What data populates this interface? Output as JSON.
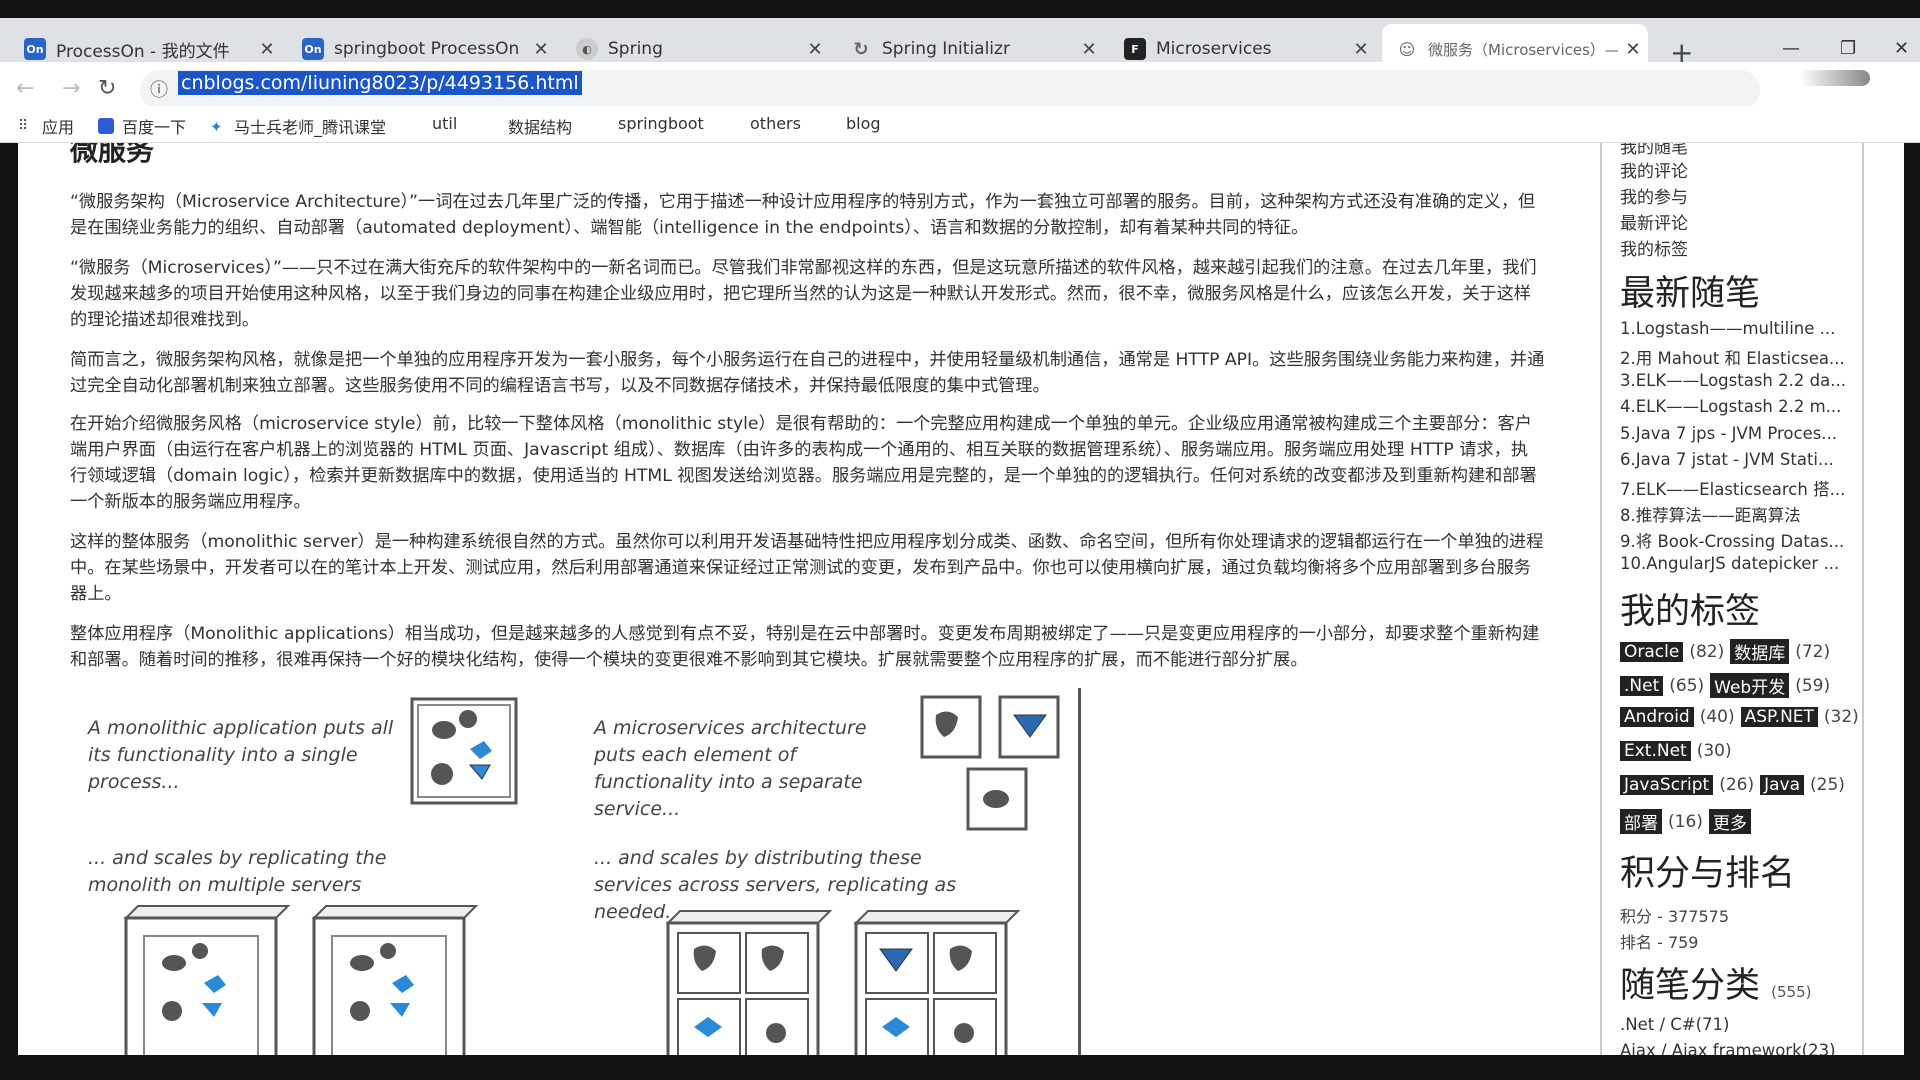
{
  "tabs": [
    {
      "title": "ProcessOn - 我的文件",
      "icon": "On",
      "color": "#2b64c6"
    },
    {
      "title": "springboot ProcessOn Mi",
      "icon": "On",
      "color": "#2b64c6"
    },
    {
      "title": "Spring",
      "icon": "spring-icon",
      "color": "#555"
    },
    {
      "title": "Spring Initializr",
      "icon": "refresh-icon",
      "color": "#555"
    },
    {
      "title": "Microservices",
      "icon": "F",
      "color": "#222"
    },
    {
      "title": "微服务（Microservices）—",
      "icon": "user-icon",
      "color": "#555"
    }
  ],
  "url": "cnblogs.com/liuning8023/p/4493156.html",
  "bookmarks": [
    "应用",
    "百度一下",
    "马士兵老师_腾讯课堂",
    "util",
    "数据结构",
    "springboot",
    "others",
    "blog"
  ],
  "article": {
    "title_fragment": "微服务",
    "paragraphs": [
      "“微服务架构（Microservice Architecture）”一词在过去几年里广泛的传播，它用于描述一种设计应用程序的特别方式，作为一套独立可部署的服务。目前，这种架构方式还没有准确的定义，但是在围绕业务能力的组织、自动部署（automated deployment）、端智能（intelligence in the endpoints）、语言和数据的分散控制，却有着某种共同的特征。",
      "“微服务（Microservices）”——只不过在满大街充斥的软件架构中的一新名词而已。尽管我们非常鄙视这样的东西，但是这玩意所描述的软件风格，越来越引起我们的注意。在过去几年里，我们发现越来越多的项目开始使用这种风格，以至于我们身边的同事在构建企业级应用时，把它理所当然的认为这是一种默认开发形式。然而，很不幸，微服务风格是什么，应该怎么开发，关于这样的理论描述却很难找到。",
      "简而言之，微服务架构风格，就像是把一个单独的应用程序开发为一套小服务，每个小服务运行在自己的进程中，并使用轻量级机制通信，通常是 HTTP API。这些服务围绕业务能力来构建，并通过完全自动化部署机制来独立部署。这些服务使用不同的编程语言书写，以及不同数据存储技术，并保持最低限度的集中式管理。",
      "在开始介绍微服务风格（microservice style）前，比较一下整体风格（monolithic style）是很有帮助的：一个完整应用构建成一个单独的单元。企业级应用通常被构建成三个主要部分：客户端用户界面（由运行在客户机器上的浏览器的 HTML 页面、Javascript 组成）、数据库（由许多的表构成一个通用的、相互关联的数据管理系统）、服务端应用。服务端应用处理 HTTP 请求，执行领域逻辑（domain logic），检索并更新数据库中的数据，使用适当的 HTML 视图发送给浏览器。服务端应用是完整的，是一个单独的的逻辑执行。任何对系统的改变都涉及到重新构建和部署一个新版本的服务端应用程序。",
      "这样的整体服务（monolithic server）是一种构建系统很自然的方式。虽然你可以利用开发语基础特性把应用程序划分成类、函数、命名空间，但所有你处理请求的逻辑都运行在一个单独的进程中。在某些场景中，开发者可以在的笔计本上开发、测试应用，然后利用部署通道来保证经过正常测试的变更，发布到产品中。你也可以使用横向扩展，通过负载均衡将多个应用部署到多台服务器上。",
      "整体应用程序（Monolithic applications）相当成功，但是越来越多的人感觉到有点不妥，特别是在云中部署时。变更发布周期被绑定了——只是变更应用程序的一小部分，却要求整个重新构建和部署。随着时间的推移，很难再保持一个好的模块化结构，使得一个模块的变更很难不影响到其它模块。扩展就需要整个应用程序的扩展，而不能进行部分扩展。"
    ]
  },
  "diagram": {
    "caption1": "A monolithic application puts all its functionality into a single process...",
    "caption2": "A microservices architecture puts each element of functionality into a separate service...",
    "caption3": "... and scales by replicating the monolith on multiple servers",
    "caption4": "... and scales by distributing these services across servers, replicating as needed."
  },
  "sidebar": {
    "links": [
      "我的随笔",
      "我的评论",
      "我的参与",
      "最新评论",
      "我的标签"
    ],
    "recent_title": "最新随笔",
    "recent": [
      "1.Logstash——multiline ...",
      "2.用 Mahout 和 Elasticsea...",
      "3.ELK——Logstash 2.2 da...",
      "4.ELK——Logstash 2.2 m...",
      "5.Java 7 jps - JVM Proces...",
      "6.Java 7 jstat - JVM Stati...",
      "7.ELK——Elasticsearch 搭...",
      "8.推荐算法——距离算法",
      "9.将 Book-Crossing Datas...",
      "10.AngularJS datepicker ..."
    ],
    "tags_title": "我的标签",
    "tags": [
      [
        {
          "name": "Oracle",
          "count": "(82)"
        },
        {
          "name": "数据库",
          "count": "(72)"
        }
      ],
      [
        {
          "name": ".Net",
          "count": "(65)"
        },
        {
          "name": "Web开发",
          "count": "(59)"
        }
      ],
      [
        {
          "name": "Android",
          "count": "(40)"
        },
        {
          "name": "ASP.NET",
          "count": "(32)"
        }
      ],
      [
        {
          "name": "Ext.Net",
          "count": "(30)"
        }
      ],
      [
        {
          "name": "JavaScript",
          "count": "(26)"
        },
        {
          "name": "Java",
          "count": "(25)"
        }
      ],
      [
        {
          "name": "部署",
          "count": "(16)"
        },
        {
          "name": "更多",
          "count": ""
        }
      ]
    ],
    "score_title": "积分与排名",
    "score": "积分 - 377575",
    "rank": "排名 - 759",
    "cat_title": "随笔分类",
    "cat_count": "(555)",
    "cats": [
      ".Net / C#(71)",
      "Ajax / Ajax framework(23)"
    ]
  }
}
